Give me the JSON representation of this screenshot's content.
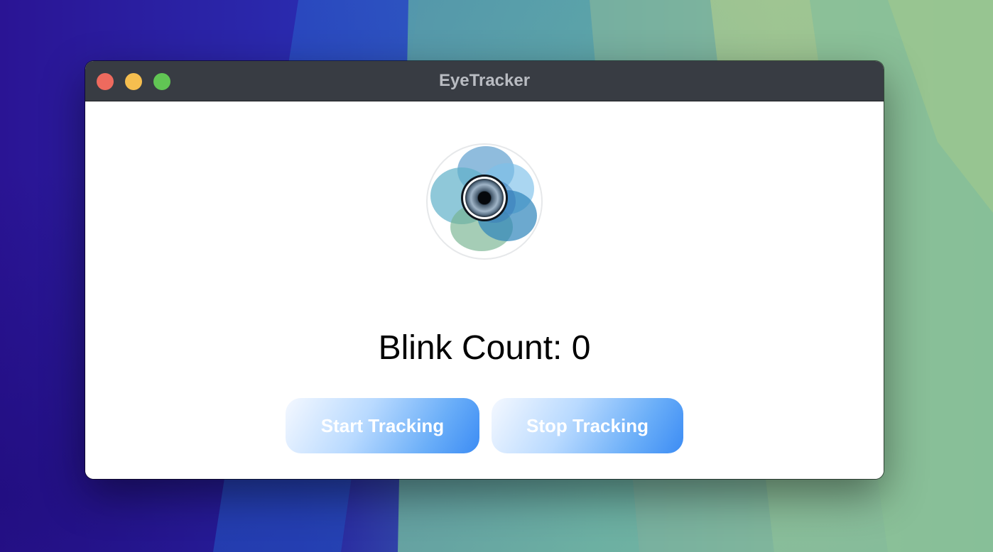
{
  "window": {
    "title": "EyeTracker"
  },
  "main": {
    "logo_icon": "eye-flower-logo",
    "blink_count_label": "Blink Count: 0"
  },
  "buttons": {
    "start_label": "Start Tracking",
    "stop_label": "Stop Tracking"
  },
  "colors": {
    "titlebar": "#383c43",
    "close": "#ee6a5e",
    "minimize": "#f5be4f",
    "zoom": "#61c554",
    "button_accent": "#3c8cf4"
  }
}
